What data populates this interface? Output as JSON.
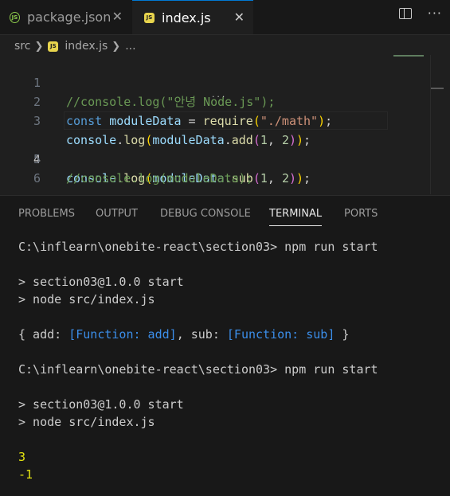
{
  "tabs": [
    {
      "label": "package.json",
      "icon": "nodejs-icon",
      "active": false
    },
    {
      "label": "index.js",
      "icon": "js-file-icon",
      "active": true
    }
  ],
  "tab_icon_text": {
    "node": "JS",
    "js": "JS"
  },
  "tab_close_glyph": "✕",
  "editor_actions": {
    "split": "split-editor-icon",
    "more_glyph": "···"
  },
  "breadcrumb": {
    "folder": "src",
    "file": "index.js",
    "more": "...",
    "separator": "❯"
  },
  "code": {
    "line_numbers": [
      "1",
      "2",
      "3",
      "4",
      "5",
      "6"
    ],
    "current_line": 4,
    "l1": {
      "comment": "//console.log(\"안녕 Node.js\");"
    },
    "l2": {
      "kw": "const",
      "var": "moduleData",
      "eq": " = ",
      "fn": "require",
      "open": "(",
      "str": "\"./math\"",
      "close": ")",
      "semi": ";"
    },
    "l3": {
      "obj": "console",
      "dot1": ".",
      "fn1": "log",
      "open1": "(",
      "var": "moduleData",
      "dot2": ".",
      "fn2": "add",
      "open2": "(",
      "n1": "1",
      "comma": ", ",
      "n2": "2",
      "close2": ")",
      "close1": ")",
      "semi": ";"
    },
    "l4": {
      "obj": "console",
      "dot1": ".",
      "fn1": "log",
      "open1": "(",
      "var": "moduleData",
      "dot2": ".",
      "fn2": "sub",
      "open2": "(",
      "n1": "1",
      "comma": ", ",
      "n2": "2",
      "close2": ")",
      "close1": ")",
      "semi": ";"
    },
    "l5": {
      "comment": "//console.log(moduleData);"
    },
    "hint_dots": "..."
  },
  "panel": {
    "tabs": [
      "PROBLEMS",
      "OUTPUT",
      "DEBUG CONSOLE",
      "TERMINAL",
      "PORTS"
    ],
    "active_tab": "TERMINAL"
  },
  "terminal": {
    "prompt1": "C:\\inflearn\\onebite-react\\section03> npm run start",
    "out1a": "> section03@1.0.0 start",
    "out1b": "> node src/index.js",
    "obj_open": "{ add: ",
    "fn_add": "[Function: add]",
    "obj_mid": ", sub: ",
    "fn_sub": "[Function: sub]",
    "obj_close": " }",
    "prompt2": "C:\\inflearn\\onebite-react\\section03> npm run start",
    "out2a": "> section03@1.0.0 start",
    "out2b": "> node src/index.js",
    "result1": "3",
    "result2": "-1"
  },
  "colors": {
    "comment": "#6a9955",
    "keyword": "#569cd6",
    "variable": "#9cdcfe",
    "function": "#dcdcaa",
    "string": "#ce9178",
    "number": "#b5cea8",
    "bracket1": "#ffd700",
    "bracket2": "#da70d6",
    "terminal_function": "#3b8eea",
    "terminal_number": "#e5e510"
  }
}
